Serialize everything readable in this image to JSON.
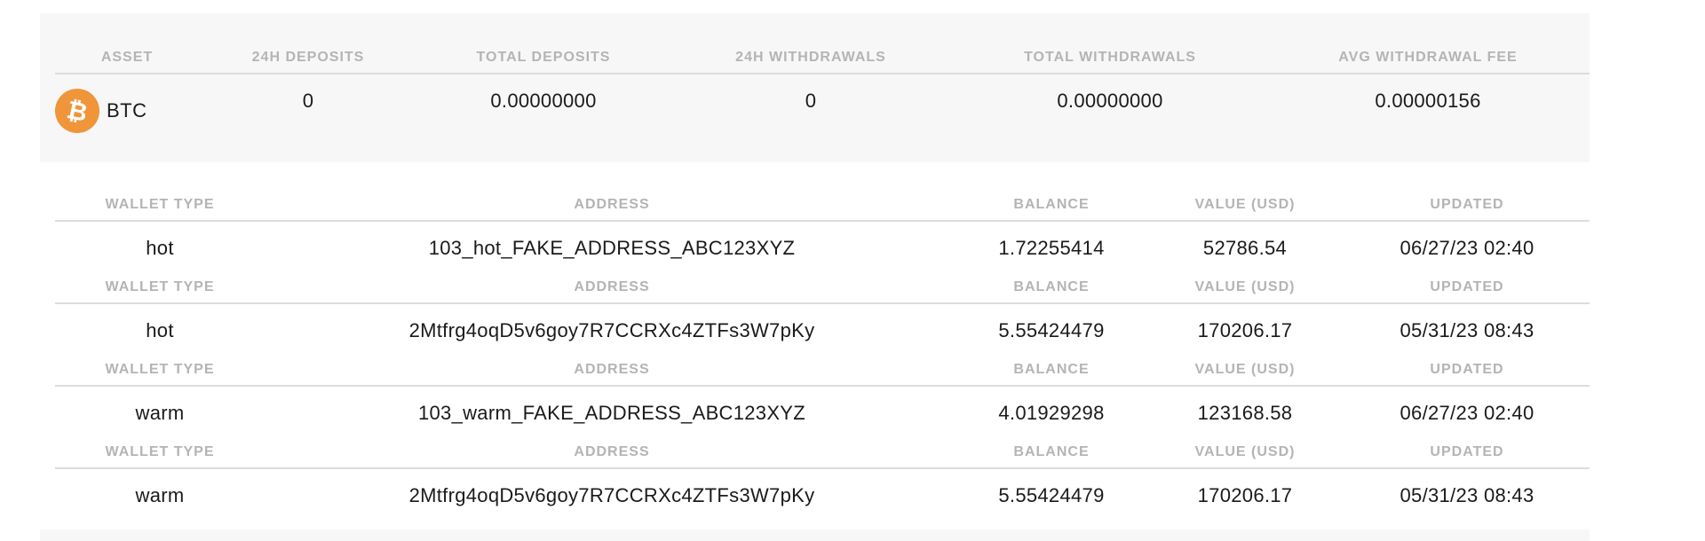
{
  "summary": {
    "headers": {
      "asset": "ASSET",
      "deposits_24h": "24H DEPOSITS",
      "total_deposits": "TOTAL DEPOSITS",
      "withdrawals_24h": "24H WITHDRAWALS",
      "total_withdrawals": "TOTAL WITHDRAWALS",
      "avg_withdrawal_fee": "AVG WITHDRAWAL FEE"
    },
    "row": {
      "asset_icon": "bitcoin-icon",
      "asset": "BTC",
      "deposits_24h": "0",
      "total_deposits": "0.00000000",
      "withdrawals_24h": "0",
      "total_withdrawals": "0.00000000",
      "avg_withdrawal_fee": "0.00000156"
    }
  },
  "wallets": [
    {
      "headers": {
        "wallet_type": "WALLET TYPE",
        "address": "ADDRESS",
        "balance": "BALANCE",
        "value_usd": "VALUE (USD)",
        "updated": "UPDATED"
      },
      "wallet_type": "hot",
      "address": "103_hot_FAKE_ADDRESS_ABC123XYZ",
      "balance": "1.72255414",
      "value_usd": "52786.54",
      "updated": "06/27/23 02:40"
    },
    {
      "headers": {
        "wallet_type": "WALLET TYPE",
        "address": "ADDRESS",
        "balance": "BALANCE",
        "value_usd": "VALUE (USD)",
        "updated": "UPDATED"
      },
      "wallet_type": "hot",
      "address": "2Mtfrg4oqD5v6goy7R7CCRXc4ZTFs3W7pKy",
      "balance": "5.55424479",
      "value_usd": "170206.17",
      "updated": "05/31/23 08:43"
    },
    {
      "headers": {
        "wallet_type": "WALLET TYPE",
        "address": "ADDRESS",
        "balance": "BALANCE",
        "value_usd": "VALUE (USD)",
        "updated": "UPDATED"
      },
      "wallet_type": "warm",
      "address": "103_warm_FAKE_ADDRESS_ABC123XYZ",
      "balance": "4.01929298",
      "value_usd": "123168.58",
      "updated": "06/27/23 02:40"
    },
    {
      "headers": {
        "wallet_type": "WALLET TYPE",
        "address": "ADDRESS",
        "balance": "BALANCE",
        "value_usd": "VALUE (USD)",
        "updated": "UPDATED"
      },
      "wallet_type": "warm",
      "address": "2Mtfrg4oqD5v6goy7R7CCRXc4ZTFs3W7pKy",
      "balance": "5.55424479",
      "value_usd": "170206.17",
      "updated": "05/31/23 08:43"
    }
  ],
  "colors": {
    "panel_bg": "#f7f7f7",
    "header_text": "#b4b4b4",
    "rule": "#dcdcdc",
    "bitcoin_orange": "#f0953a"
  }
}
